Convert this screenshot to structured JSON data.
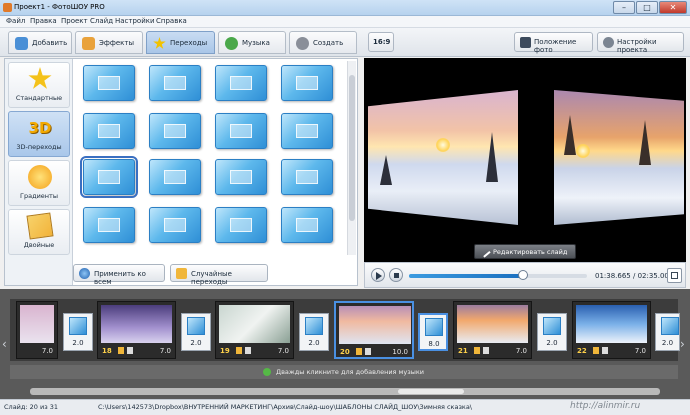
{
  "window": {
    "title": "Проект1 - ФотоШОУ PRO",
    "controls": [
      "–",
      "□",
      "✕"
    ]
  },
  "menu": [
    "Файл",
    "Правка",
    "Проект",
    "Слайд",
    "Настройки",
    "Справка"
  ],
  "tabs": [
    {
      "label": "Добавить",
      "icon": "add-photo-icon",
      "color": "#4a8fd6"
    },
    {
      "label": "Эффекты",
      "icon": "effects-icon",
      "color": "#e9a23b"
    },
    {
      "label": "Переходы",
      "icon": "transitions-star-icon",
      "color": "#f2c200",
      "active": true
    },
    {
      "label": "Музыка",
      "icon": "music-icon",
      "color": "#4aa84a"
    },
    {
      "label": "Создать",
      "icon": "create-disc-icon",
      "color": "#8a8f99"
    }
  ],
  "toolbar": {
    "aspect": "16:9",
    "photo_position": "Положение фото",
    "project_settings": "Настройки проекта"
  },
  "categories": [
    {
      "label": "Стандартные",
      "icon": "star-icon",
      "color": "#f4c21a"
    },
    {
      "label": "3D-переходы",
      "icon": "3d-icon",
      "color": "#f2a900",
      "active": true
    },
    {
      "label": "Градиенты",
      "icon": "gradient-sun-icon",
      "color": "#f4a11a"
    },
    {
      "label": "Двойные",
      "icon": "double-icon",
      "color": "#f2b33a"
    }
  ],
  "panel_buttons": {
    "apply_all": "Применить ко всем",
    "random": "Случайные переходы"
  },
  "preview": {
    "edit_slide": "Редактировать слайд"
  },
  "player": {
    "time_current": "01:38.665",
    "time_total": "02:35.000",
    "time_sep": " / ",
    "progress": 0.64
  },
  "timeline": {
    "slides": [
      {
        "num": "",
        "duration": "7.0",
        "scene": "pink"
      },
      {
        "num": "18",
        "duration": "7.0",
        "scene": "violet"
      },
      {
        "num": "19",
        "duration": "7.0",
        "scene": "bird"
      },
      {
        "num": "20",
        "duration": "10.0",
        "scene": "sunset",
        "active": true
      },
      {
        "num": "21",
        "duration": "7.0",
        "scene": "sunset2"
      },
      {
        "num": "22",
        "duration": "7.0",
        "scene": "ski"
      }
    ],
    "transitions": [
      "2.0",
      "2.0",
      "2.0",
      "8.0",
      "2.0",
      "2.0"
    ],
    "music_hint": "Дважды кликните для добавления музыки"
  },
  "status": {
    "slide": "Слайд: 20 из 31",
    "path": "C:\\Users\\142573\\Dropbox\\ВНУТРЕННИЙ МАРКЕТИНГ\\Архив\\Слайд-шоу\\ШАБЛОНЫ СЛАЙД_ШОУ\\Зимняя сказка\\"
  },
  "watermark": "http://alinmir.ru"
}
